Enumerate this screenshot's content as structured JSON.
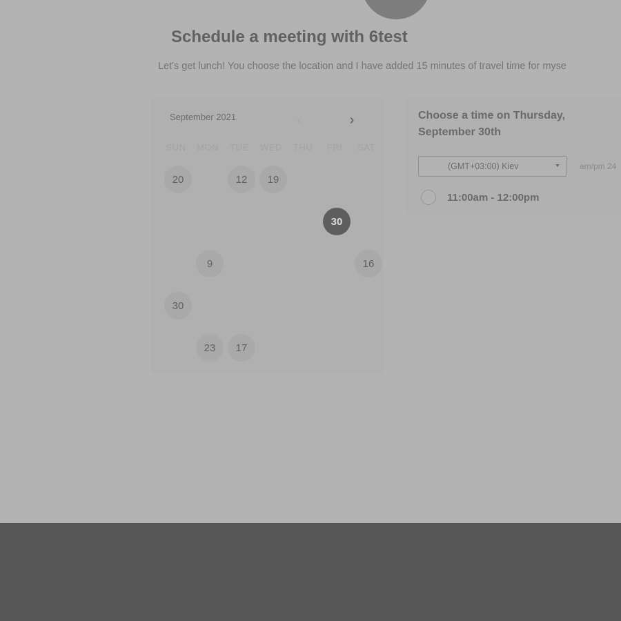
{
  "header": {
    "title": "Schedule a meeting with 6test",
    "subtitle": "Let's get lunch! You choose the location and I have added 15 minutes of travel time for myse"
  },
  "calendar": {
    "month_label": "September 2021",
    "prev_icon": "chevron-left-icon",
    "next_icon": "chevron-right-icon",
    "prev_glyph": "‹",
    "next_glyph": "›",
    "weekdays": [
      "SUN",
      "MON",
      "TUE",
      "WED",
      "THU",
      "FRI",
      "SAT"
    ],
    "days": [
      {
        "label": "20",
        "state": "available",
        "col": 0,
        "row": 0
      },
      {
        "label": "12",
        "state": "available",
        "col": 2,
        "row": 0
      },
      {
        "label": "19",
        "state": "available",
        "col": 3,
        "row": 0
      },
      {
        "label": "30",
        "state": "selected",
        "col": 5,
        "row": 1
      },
      {
        "label": "9",
        "state": "available",
        "col": 1,
        "row": 2
      },
      {
        "label": "16",
        "state": "available",
        "col": 6,
        "row": 2
      },
      {
        "label": "30",
        "state": "available",
        "col": 0,
        "row": 3
      },
      {
        "label": "23",
        "state": "available",
        "col": 1,
        "row": 4
      },
      {
        "label": "17",
        "state": "available",
        "col": 2,
        "row": 4
      }
    ]
  },
  "time_panel": {
    "heading": "Choose a time on Thursday, September 30th",
    "timezone": "(GMT+03:00) Kiev",
    "format_toggle": "am/pm  24",
    "slots": [
      "11:00am - 12:00pm"
    ]
  },
  "colors": {
    "selected_day": "#5e5e5e",
    "footer_band": "#575757"
  }
}
